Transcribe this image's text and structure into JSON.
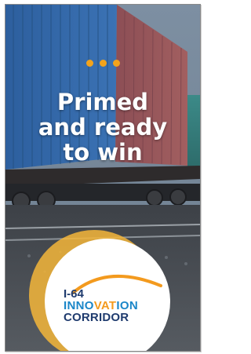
{
  "headline": {
    "line1": "Primed",
    "line2": "and ready",
    "line3": "to win"
  },
  "logo": {
    "line1": "I-64",
    "line2_pre": "INNO",
    "line2_accent": "VAT",
    "line2_post": "ION",
    "line3": "CORRIDOR"
  },
  "colors": {
    "accent_orange": "#f3a31b",
    "logo_navy": "#1f3b6e",
    "logo_blue": "#1a86c8"
  },
  "icons": [
    "three-dots-icon",
    "orange-arc-icon"
  ]
}
